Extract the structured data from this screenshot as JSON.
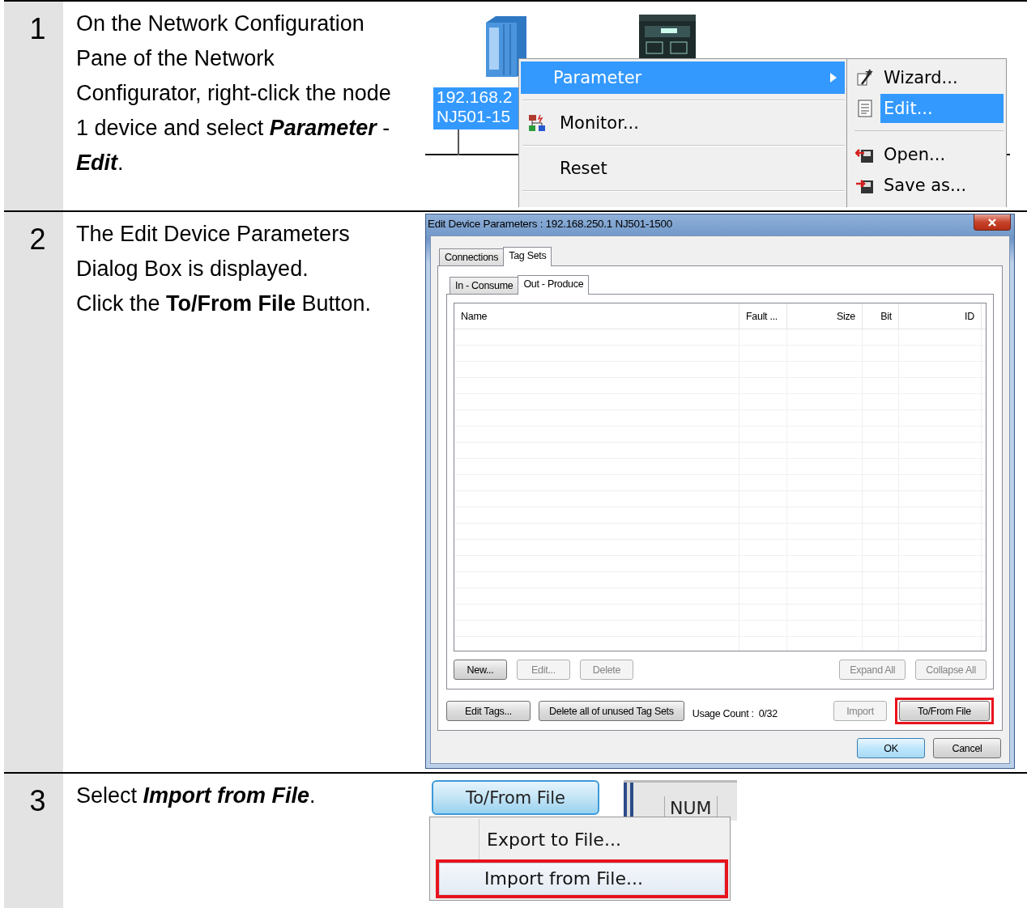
{
  "steps": [
    {
      "number": "1",
      "paragraphs": [
        {
          "text": "On the Network Configuration Pane of the Network Configurator, right-click the node 1 device and select **Parameter** - **Edit**.",
          "kind": "bold-italic"
        }
      ],
      "figure": {
        "kind": "context-menu",
        "node_label": [
          "192.168.2",
          "NJ501-15"
        ],
        "menu": [
          {
            "label": "Parameter",
            "kind": "plain",
            "selected": true,
            "submenu": true
          },
          {
            "label": "Monitor...",
            "kind": "monitor",
            "selected": false,
            "submenu": false
          },
          {
            "label": "Reset",
            "kind": "plain",
            "selected": false,
            "submenu": false
          }
        ],
        "submenu": [
          {
            "label": "Wizard...",
            "kind": "wizard",
            "selected": false,
            "separator_after": false
          },
          {
            "label": "Edit...",
            "kind": "edit",
            "selected": true,
            "separator_after": true
          },
          {
            "label": "Open...",
            "kind": "open",
            "selected": false,
            "separator_after": false
          },
          {
            "label": "Save as...",
            "kind": "save",
            "selected": false,
            "separator_after": false
          }
        ]
      }
    },
    {
      "number": "2",
      "paragraphs": [
        {
          "text": "The Edit Device Parameters Dialog Box is displayed.",
          "kind": "bold"
        },
        {
          "text": "Click the **To/From File** Button.",
          "kind": "bold"
        }
      ],
      "figure": {
        "kind": "dialog",
        "title": "Edit Device Parameters : 192.168.250.1 NJ501-1500",
        "tabs": [
          {
            "label": "Connections",
            "selected": false
          },
          {
            "label": "Tag Sets",
            "selected": true
          }
        ],
        "subtabs": [
          {
            "label": "In - Consume",
            "selected": false
          },
          {
            "label": "Out - Produce",
            "selected": true
          }
        ],
        "columns": [
          "Name",
          "Fault ...",
          "Size",
          "Bit",
          "ID"
        ],
        "list_buttons_left": [
          {
            "label": "New...",
            "disabled": false
          },
          {
            "label": "Edit...",
            "disabled": true
          },
          {
            "label": "Delete",
            "disabled": true
          }
        ],
        "list_buttons_right": [
          {
            "label": "Expand All",
            "disabled": true
          },
          {
            "label": "Collapse All",
            "disabled": true
          }
        ],
        "tag_buttons": [
          {
            "label": "Edit Tags...",
            "disabled": false
          },
          {
            "label": "Delete all of unused Tag Sets",
            "disabled": false
          }
        ],
        "usage_label": "Usage Count :",
        "usage_value": "0/32",
        "file_buttons": [
          {
            "label": "Import",
            "disabled": true,
            "highlighted": false
          },
          {
            "label": "To/From File",
            "disabled": false,
            "highlighted": true
          }
        ],
        "dialog_buttons": [
          {
            "label": "OK",
            "default": true
          },
          {
            "label": "Cancel",
            "default": false
          }
        ]
      }
    },
    {
      "number": "3",
      "paragraphs": [
        {
          "text": "Select **Import from File**.",
          "kind": "bold-italic"
        }
      ],
      "figure": {
        "kind": "dropdown",
        "button": "To/From File",
        "status": "NUM",
        "menu": [
          {
            "label": "Export to File...",
            "highlighted": false
          },
          {
            "label": "Import from File...",
            "highlighted": true
          }
        ]
      }
    }
  ]
}
